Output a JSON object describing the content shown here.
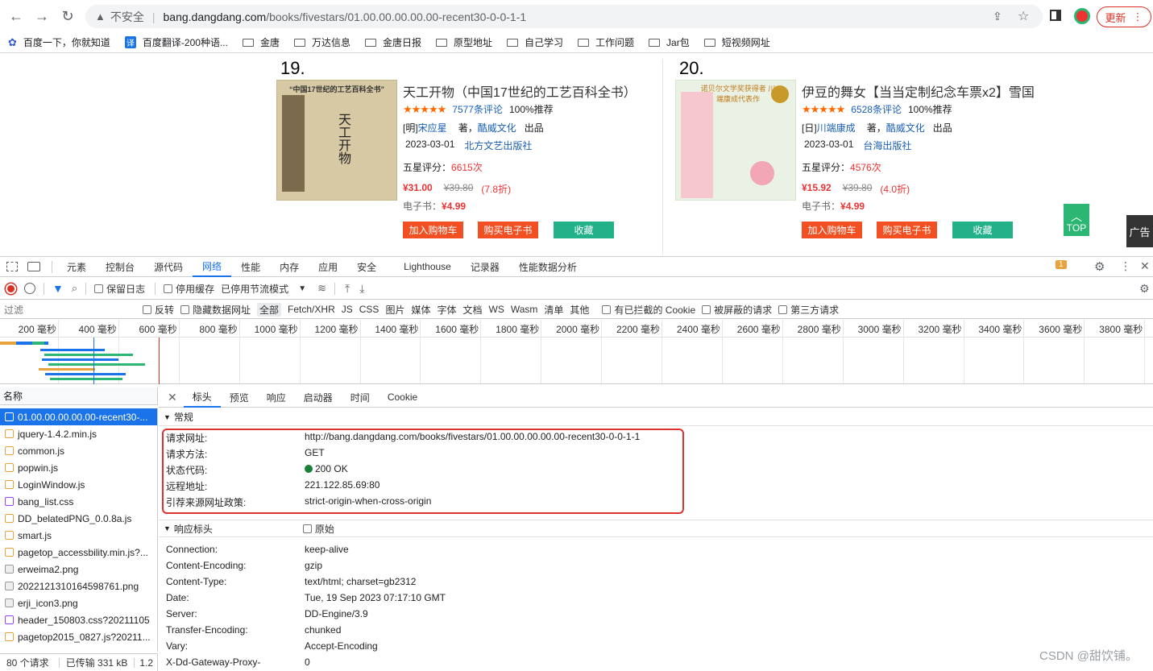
{
  "browser": {
    "security_label": "不安全",
    "url_host": "bang.dangdang.com",
    "url_path": "/books/fivestars/01.00.00.00.00.00-recent30-0-0-1-1",
    "update_label": "更新"
  },
  "bookmarks": [
    {
      "label": "百度一下，你就知道",
      "icon": "baidu-icon"
    },
    {
      "label": "百度翻译-200种语...",
      "icon": "translate-icon"
    },
    {
      "label": "金唐",
      "icon": "folder-icon"
    },
    {
      "label": "万达信息",
      "icon": "folder-icon"
    },
    {
      "label": "金唐日报",
      "icon": "folder-icon"
    },
    {
      "label": "原型地址",
      "icon": "folder-icon"
    },
    {
      "label": "自己学习",
      "icon": "folder-icon"
    },
    {
      "label": "工作问题",
      "icon": "folder-icon"
    },
    {
      "label": "Jar包",
      "icon": "folder-icon"
    },
    {
      "label": "短视频网址",
      "icon": "folder-icon"
    }
  ],
  "books": [
    {
      "rank": "19.",
      "title": "天工开物（中国17世纪的工艺百科全书）",
      "reviews": "7577条评论",
      "recommend": "100%推荐",
      "author_prefix": "[明]",
      "author": "宋应星",
      "author_suffix": "著，",
      "publisher_brand": "酷威文化",
      "publish_label": "出品",
      "date": "2023-03-01",
      "press": "北方文艺出版社",
      "five_star_label": "五星评分：",
      "five_star_count": "6615次",
      "price": "¥31.00",
      "orig_price": "¥39.80",
      "discount": "(7.8折)",
      "ebook_label": "电子书：",
      "ebook_price": "¥4.99",
      "cover_caption": "“中国17世纪的工艺百科全书”"
    },
    {
      "rank": "20.",
      "title": "伊豆的舞女【当当定制纪念车票x2】雪国",
      "reviews": "6528条评论",
      "recommend": "100%推荐",
      "author_prefix": "[日]",
      "author": "川端康成",
      "author_suffix": "著，",
      "publisher_brand": "酷威文化",
      "publish_label": "出品",
      "date": "2023-03-01",
      "press": "台海出版社",
      "five_star_label": "五星评分：",
      "five_star_count": "4576次",
      "price": "¥15.92",
      "orig_price": "¥39.80",
      "discount": "(4.0折)",
      "ebook_label": "电子书：",
      "ebook_price": "¥4.99",
      "cover_caption": "诺贝尔文学奖获得者 川端康成代表作"
    }
  ],
  "actions": {
    "cart": "加入购物车",
    "ebook": "购买电子书",
    "fav": "收藏"
  },
  "top_label": "TOP",
  "ad_label": "广告",
  "devtools": {
    "tabs": [
      "元素",
      "控制台",
      "源代码",
      "网络",
      "性能",
      "内存",
      "应用",
      "安全",
      "Lighthouse",
      "记录器",
      "性能数据分析"
    ],
    "active_tab": "网络",
    "issue_count": "1",
    "preserve_log": "保留日志",
    "disable_cache": "停用缓存",
    "throttle": "已停用节流模式",
    "filter_placeholder": "过滤",
    "filters": [
      "反转",
      "隐藏数据网址",
      "全部",
      "Fetch/XHR",
      "JS",
      "CSS",
      "图片",
      "媒体",
      "字体",
      "文档",
      "WS",
      "Wasm",
      "清单",
      "其他",
      "有已拦截的 Cookie",
      "被屏蔽的请求",
      "第三方请求"
    ],
    "timeline_ticks": [
      "200 毫秒",
      "400 毫秒",
      "600 毫秒",
      "800 毫秒",
      "1000 毫秒",
      "1200 毫秒",
      "1400 毫秒",
      "1600 毫秒",
      "1800 毫秒",
      "2000 毫秒",
      "2200 毫秒",
      "2400 毫秒",
      "2600 毫秒",
      "2800 毫秒",
      "3000 毫秒",
      "3200 毫秒",
      "3400 毫秒",
      "3600 毫秒",
      "3800 毫秒"
    ],
    "name_header": "名称",
    "requests": [
      "01.00.00.00.00.00-recent30-...",
      "jquery-1.4.2.min.js",
      "common.js",
      "popwin.js",
      "LoginWindow.js",
      "bang_list.css",
      "DD_belatedPNG_0.0.8a.js",
      "smart.js",
      "pagetop_accessbility.min.js?...",
      "erweima2.png",
      "2022121310164598761.png",
      "erji_icon3.png",
      "header_150803.css?20211105",
      "pagetop2015_0827.js?20211..."
    ],
    "status_bar": {
      "count": "80 个请求",
      "transferred": "已传输 331 kB",
      "extra": "1.2"
    },
    "detail_tabs": [
      "标头",
      "预览",
      "响应",
      "启动器",
      "时间",
      "Cookie"
    ],
    "general_title": "常规",
    "general": [
      {
        "k": "请求网址:",
        "v": "http://bang.dangdang.com/books/fivestars/01.00.00.00.00.00-recent30-0-0-1-1"
      },
      {
        "k": "请求方法:",
        "v": "GET"
      },
      {
        "k": "状态代码:",
        "v": "200 OK"
      },
      {
        "k": "远程地址:",
        "v": "221.122.85.69:80"
      },
      {
        "k": "引荐来源网址政策:",
        "v": "strict-origin-when-cross-origin"
      }
    ],
    "response_title": "响应标头",
    "raw_label": "原始",
    "response": [
      {
        "k": "Connection:",
        "v": "keep-alive"
      },
      {
        "k": "Content-Encoding:",
        "v": "gzip"
      },
      {
        "k": "Content-Type:",
        "v": "text/html; charset=gb2312"
      },
      {
        "k": "Date:",
        "v": "Tue, 19 Sep 2023 07:17:10 GMT"
      },
      {
        "k": "Server:",
        "v": "DD-Engine/3.9"
      },
      {
        "k": "Transfer-Encoding:",
        "v": "chunked"
      },
      {
        "k": "Vary:",
        "v": "Accept-Encoding"
      },
      {
        "k": "X-Dd-Gateway-Proxy-",
        "v": "0"
      }
    ]
  },
  "watermark": "CSDN @甜饮铺。"
}
